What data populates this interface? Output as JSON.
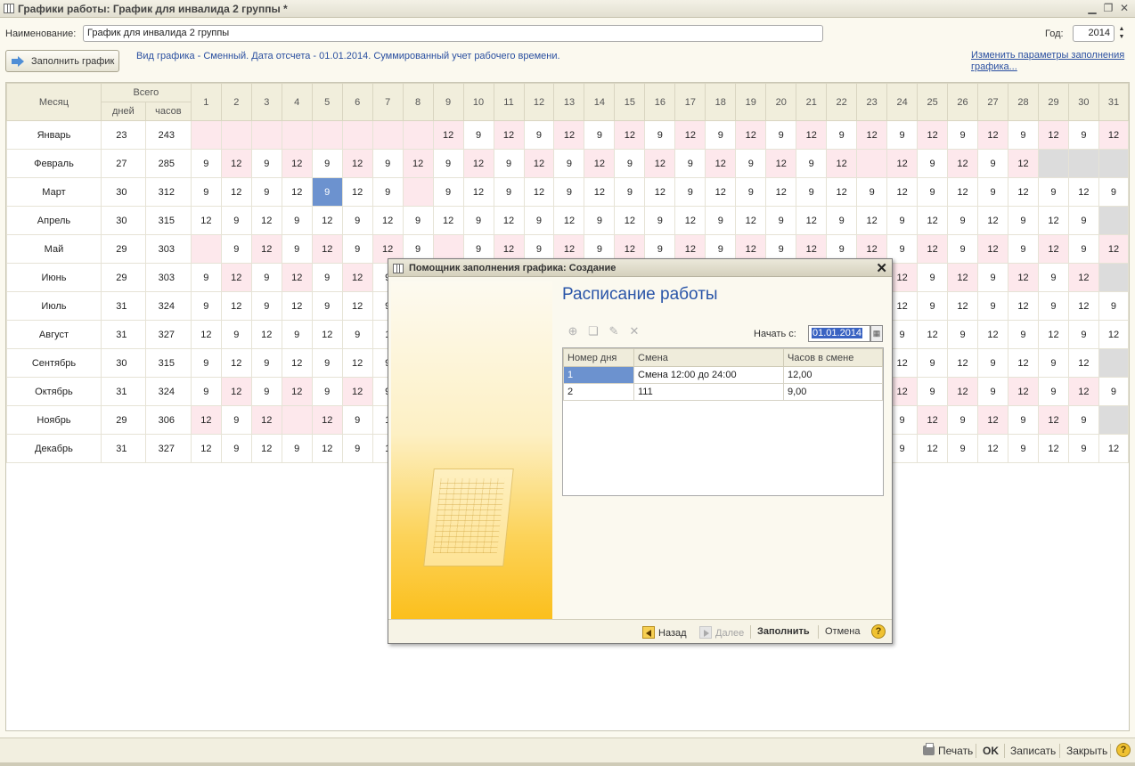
{
  "window": {
    "title": "Графики работы: График для инвалида 2 группы *"
  },
  "form": {
    "name_label": "Наименование:",
    "name_value": "График для инвалида 2 группы",
    "year_label": "Год:",
    "year_value": "2014",
    "fill_button": "Заполнить график",
    "info_text": "Вид графика - Сменный. Дата отсчета - 01.01.2014. Суммированный учет рабочего времени.",
    "change_params_link": "Изменить параметры заполнения графика..."
  },
  "grid": {
    "header": {
      "month": "Месяц",
      "total": "Всего",
      "days": "дней",
      "hours": "часов"
    },
    "day_numbers": [
      "1",
      "2",
      "3",
      "4",
      "5",
      "6",
      "7",
      "8",
      "9",
      "10",
      "11",
      "12",
      "13",
      "14",
      "15",
      "16",
      "17",
      "18",
      "19",
      "20",
      "21",
      "22",
      "23",
      "24",
      "25",
      "26",
      "27",
      "28",
      "29",
      "30",
      "31"
    ],
    "rows": [
      {
        "month": "Январь",
        "days": "23",
        "hours": "243",
        "cells": [
          "",
          "",
          "",
          "",
          "",
          "",
          "",
          "",
          "12",
          "9",
          "12",
          "9",
          "12",
          "9",
          "12",
          "9",
          "12",
          "9",
          "12",
          "9",
          "12",
          "9",
          "12",
          "9",
          "12",
          "9",
          "12",
          "9",
          "12",
          "9",
          "12"
        ]
      },
      {
        "month": "Февраль",
        "days": "27",
        "hours": "285",
        "cells": [
          "9",
          "12",
          "9",
          "12",
          "9",
          "12",
          "9",
          "12",
          "9",
          "12",
          "9",
          "12",
          "9",
          "12",
          "9",
          "12",
          "9",
          "12",
          "9",
          "12",
          "9",
          "12",
          "",
          "12",
          "9",
          "12",
          "9",
          "12",
          "",
          "",
          ""
        ]
      },
      {
        "month": "Март",
        "days": "30",
        "hours": "312",
        "cells": [
          "9",
          "12",
          "9",
          "12",
          "9",
          "12",
          "9",
          "",
          "9",
          "12",
          "9",
          "12",
          "9",
          "12",
          "9",
          "12",
          "9",
          "12",
          "9",
          "12",
          "9",
          "12",
          "9",
          "12",
          "9",
          "12",
          "9",
          "12",
          "9",
          "12",
          "9"
        ]
      },
      {
        "month": "Апрель",
        "days": "30",
        "hours": "315",
        "cells": [
          "12",
          "9",
          "12",
          "9",
          "12",
          "9",
          "12",
          "9",
          "12",
          "9",
          "12",
          "9",
          "12",
          "9",
          "12",
          "9",
          "12",
          "9",
          "12",
          "9",
          "12",
          "9",
          "12",
          "9",
          "12",
          "9",
          "12",
          "9",
          "12",
          "9",
          ""
        ]
      },
      {
        "month": "Май",
        "days": "29",
        "hours": "303",
        "cells": [
          "",
          "9",
          "12",
          "9",
          "12",
          "9",
          "12",
          "9",
          "",
          "9",
          "12",
          "9",
          "12",
          "9",
          "12",
          "9",
          "12",
          "9",
          "12",
          "9",
          "12",
          "9",
          "12",
          "9",
          "12",
          "9",
          "12",
          "9",
          "12",
          "9",
          "12"
        ]
      },
      {
        "month": "Июнь",
        "days": "29",
        "hours": "303",
        "cells": [
          "9",
          "12",
          "9",
          "12",
          "9",
          "12",
          "9",
          "",
          "",
          "",
          "",
          "",
          "",
          "",
          "",
          "",
          "",
          "",
          "",
          "",
          "",
          "",
          "",
          "12",
          "9",
          "12",
          "9",
          "12",
          "9",
          "12",
          ""
        ]
      },
      {
        "month": "Июль",
        "days": "31",
        "hours": "324",
        "cells": [
          "9",
          "12",
          "9",
          "12",
          "9",
          "12",
          "9",
          "",
          "",
          "",
          "",
          "",
          "",
          "",
          "",
          "",
          "",
          "",
          "",
          "",
          "",
          "",
          "",
          "12",
          "9",
          "12",
          "9",
          "12",
          "9",
          "12",
          "9"
        ]
      },
      {
        "month": "Август",
        "days": "31",
        "hours": "327",
        "cells": [
          "12",
          "9",
          "12",
          "9",
          "12",
          "9",
          "1",
          "",
          "",
          "",
          "",
          "",
          "",
          "",
          "",
          "",
          "",
          "",
          "",
          "",
          "",
          "",
          "",
          "9",
          "12",
          "9",
          "12",
          "9",
          "12",
          "9",
          "12"
        ]
      },
      {
        "month": "Сентябрь",
        "days": "30",
        "hours": "315",
        "cells": [
          "9",
          "12",
          "9",
          "12",
          "9",
          "12",
          "9",
          "",
          "",
          "",
          "",
          "",
          "",
          "",
          "",
          "",
          "",
          "",
          "",
          "",
          "",
          "",
          "",
          "12",
          "9",
          "12",
          "9",
          "12",
          "9",
          "12",
          ""
        ]
      },
      {
        "month": "Октябрь",
        "days": "31",
        "hours": "324",
        "cells": [
          "9",
          "12",
          "9",
          "12",
          "9",
          "12",
          "9",
          "",
          "",
          "",
          "",
          "",
          "",
          "",
          "",
          "",
          "",
          "",
          "",
          "",
          "",
          "",
          "",
          "12",
          "9",
          "12",
          "9",
          "12",
          "9",
          "12",
          "9"
        ]
      },
      {
        "month": "Ноябрь",
        "days": "29",
        "hours": "306",
        "cells": [
          "12",
          "9",
          "12",
          "",
          "12",
          "9",
          "1",
          "",
          "",
          "",
          "",
          "",
          "",
          "",
          "",
          "",
          "",
          "",
          "",
          "",
          "",
          "",
          "",
          "9",
          "12",
          "9",
          "12",
          "9",
          "12",
          "9",
          ""
        ]
      },
      {
        "month": "Декабрь",
        "days": "31",
        "hours": "327",
        "cells": [
          "12",
          "9",
          "12",
          "9",
          "12",
          "9",
          "1",
          "",
          "",
          "",
          "",
          "",
          "",
          "",
          "",
          "",
          "",
          "",
          "",
          "",
          "",
          "",
          "",
          "9",
          "12",
          "9",
          "12",
          "9",
          "12",
          "9",
          "12"
        ]
      }
    ]
  },
  "dialog": {
    "title": "Помощник заполнения графика: Создание",
    "heading": "Расписание работы",
    "start_label": "Начать с:",
    "start_value": "01.01.2014",
    "columns": [
      "Номер дня",
      "Смена",
      "Часов в смене"
    ],
    "rows": [
      {
        "day": "1",
        "shift": "Смена 12:00 до 24:00",
        "hours": "12,00"
      },
      {
        "day": "2",
        "shift": "111",
        "hours": "9,00"
      }
    ],
    "back": "Назад",
    "next": "Далее",
    "fill": "Заполнить",
    "cancel": "Отмена",
    "help": "?"
  },
  "statusbar": {
    "print": "Печать",
    "ok": "OK",
    "save": "Записать",
    "close": "Закрыть",
    "help": "?"
  }
}
